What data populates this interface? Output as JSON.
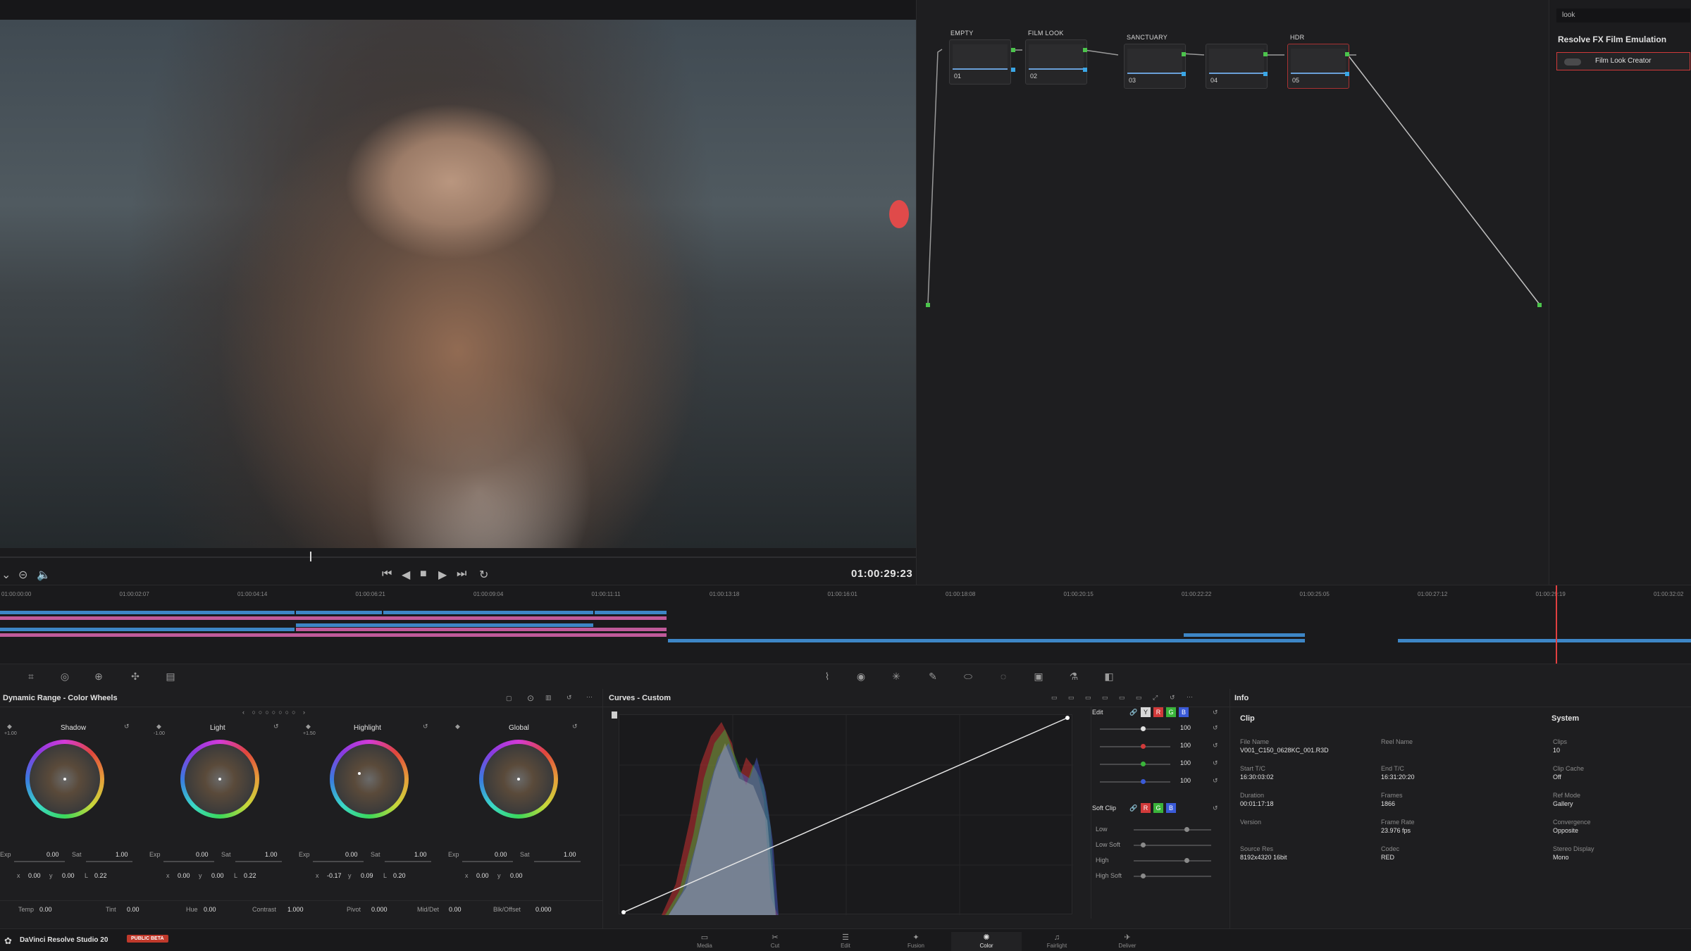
{
  "viewer": {
    "timecode": "01:00:29:23"
  },
  "nodes": [
    {
      "label": "EMPTY",
      "num": "01"
    },
    {
      "label": "FILM LOOK",
      "num": "02"
    },
    {
      "label": "SANCTUARY",
      "num": "03"
    },
    {
      "label": "",
      "num": "04"
    },
    {
      "label": "HDR",
      "num": "05"
    }
  ],
  "fx": {
    "search": "look",
    "title": "Resolve FX Film Emulation",
    "item": "Film Look Creator"
  },
  "ruler": [
    "01:00:00:00",
    "01:00:02:07",
    "01:00:04:14",
    "01:00:06:21",
    "01:00:09:04",
    "01:00:11:11",
    "01:00:13:18",
    "01:00:16:01",
    "01:00:18:08",
    "01:00:20:15",
    "01:00:22:22",
    "01:00:25:05",
    "01:00:27:12",
    "01:00:29:19",
    "01:00:32:02"
  ],
  "wheels_panel": {
    "title": "Dynamic Range - Color Wheels",
    "wheels": [
      {
        "name": "Shadow",
        "top_val": "+1.00",
        "exp": "0.00",
        "sat": "1.00",
        "x": "0.00",
        "y": "0.00",
        "l": "0.22"
      },
      {
        "name": "Light",
        "top_val": "-1.00",
        "exp": "0.00",
        "sat": "1.00",
        "x": "0.00",
        "y": "0.00",
        "l": "0.22"
      },
      {
        "name": "Highlight",
        "top_val": "+1.50",
        "exp": "0.00",
        "sat": "1.00",
        "x": "-0.17",
        "y": "0.09",
        "l": "0.20"
      },
      {
        "name": "Global",
        "top_val": "",
        "exp": "0.00",
        "sat": "1.00",
        "x": "0.00",
        "y": "0.00",
        "l": ""
      }
    ],
    "labels": {
      "exp": "Exp",
      "sat": "Sat",
      "x": "x",
      "y": "y",
      "l": "L"
    },
    "bottom": [
      {
        "key": "Temp",
        "val": "0.00"
      },
      {
        "key": "Tint",
        "val": "0.00"
      },
      {
        "key": "Hue",
        "val": "0.00"
      },
      {
        "key": "Contrast",
        "val": "1.000"
      },
      {
        "key": "Pivot",
        "val": "0.000"
      },
      {
        "key": "Mid/Det",
        "val": "0.00"
      },
      {
        "key": "Blk/Offset",
        "val": "0.000"
      }
    ]
  },
  "curves": {
    "title": "Curves - Custom",
    "edit_label": "Edit",
    "channel_y": "Y",
    "channel_r": "R",
    "channel_g": "G",
    "channel_b": "B",
    "edit_values": [
      "100",
      "100",
      "100",
      "100"
    ],
    "soft_clip_label": "Soft Clip",
    "soft_rows": [
      "Low",
      "Low Soft",
      "High",
      "High Soft"
    ]
  },
  "info": {
    "title": "Info",
    "clip_head": "Clip",
    "system_head": "System",
    "clip": [
      {
        "k": "File Name",
        "v": "V001_C150_0628KC_001.R3D"
      },
      {
        "k": "Reel Name",
        "v": ""
      },
      {
        "k": "Start T/C",
        "v": "16:30:03:02"
      },
      {
        "k": "End T/C",
        "v": "16:31:20:20"
      },
      {
        "k": "Duration",
        "v": "00:01:17:18"
      },
      {
        "k": "Frames",
        "v": "1866"
      },
      {
        "k": "Version",
        "v": ""
      },
      {
        "k": "Frame Rate",
        "v": "23.976 fps"
      },
      {
        "k": "Source Res",
        "v": "8192x4320 16bit"
      },
      {
        "k": "Codec",
        "v": "RED"
      }
    ],
    "system": [
      {
        "k": "Clips",
        "v": "10"
      },
      {
        "k": "Clip Cache",
        "v": "Off"
      },
      {
        "k": "Ref Mode",
        "v": "Gallery"
      },
      {
        "k": "Convergence",
        "v": "Opposite"
      },
      {
        "k": "Stereo Display",
        "v": "Mono"
      }
    ]
  },
  "status": {
    "app": "DaVinci Resolve Studio 20",
    "badge": "PUBLIC BETA"
  },
  "pages": [
    {
      "label": "Media",
      "icon": "media-icon"
    },
    {
      "label": "Cut",
      "icon": "cut-icon"
    },
    {
      "label": "Edit",
      "icon": "edit-icon"
    },
    {
      "label": "Fusion",
      "icon": "fusion-icon"
    },
    {
      "label": "Color",
      "icon": "color-icon"
    },
    {
      "label": "Fairlight",
      "icon": "fairlight-icon"
    },
    {
      "label": "Deliver",
      "icon": "deliver-icon"
    }
  ],
  "colors": {
    "accent_red": "#d13a3a",
    "node_green": "#4cc44c",
    "node_blue": "#3aa6e6",
    "clip_blue": "#3d86c6",
    "clip_pink": "#c05a9a"
  }
}
